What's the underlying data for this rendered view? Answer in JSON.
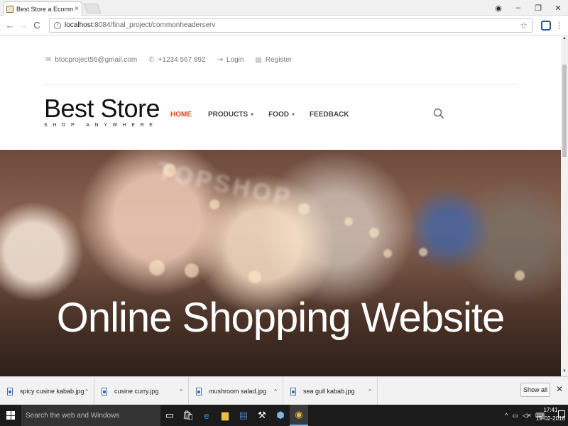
{
  "browser": {
    "tab_title": "Best Store a Ecommerce",
    "tab_close": "×",
    "window_controls": [
      "◉",
      "–",
      "❐",
      "✕"
    ],
    "url_host": "localhost",
    "url_path": ":8084/final_project/commonheaderserv",
    "nav_back": "←",
    "nav_forward": "→",
    "nav_reload": "C",
    "star": "☆",
    "menu": "⋮"
  },
  "header": {
    "email": "btocproject56@gmail.com",
    "phone": "+1234 567 892",
    "login": "Login",
    "register": "Register",
    "email_icon": "✉",
    "phone_icon": "✆",
    "login_icon": "⇥",
    "register_icon": "▤"
  },
  "brand": {
    "name": "Best Store",
    "tagline": "SHOP ANYWHERE"
  },
  "nav": [
    {
      "label": "HOME",
      "caret": ""
    },
    {
      "label": "PRODUCTS",
      "caret": "▼"
    },
    {
      "label": "FOOD",
      "caret": "▼"
    },
    {
      "label": "FEEDBACK",
      "caret": ""
    }
  ],
  "nav_active_color": "#d14a24",
  "hero": {
    "headline": "Online Shopping Website",
    "sign": "TOPSHOP"
  },
  "downloads": {
    "files": [
      "spicy cusine kabab.jpg",
      "cusine curry.jpg",
      "mushroom salad.jpg",
      "sea gull kabab.jpg"
    ],
    "chevron": "^",
    "show_all": "Show all",
    "close": "✕"
  },
  "taskbar": {
    "search_placeholder": "Search the web and Windows",
    "time": "17:41",
    "date": "19-02-2018",
    "tray": [
      "^",
      "▭",
      "◁×",
      "⌨"
    ],
    "icons": [
      "▭",
      "🛍",
      "e",
      "▆",
      "▤",
      "⚒",
      "⬢",
      "◉"
    ]
  }
}
